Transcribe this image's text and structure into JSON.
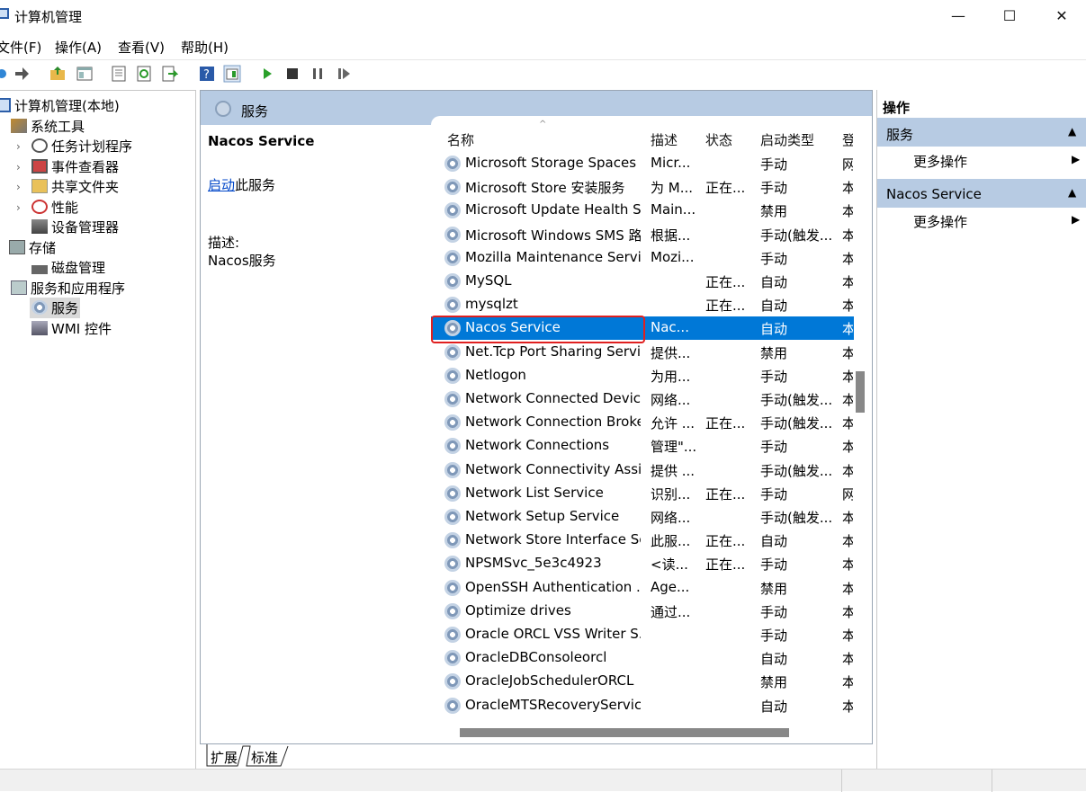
{
  "window": {
    "title": "计算机管理",
    "minimize": "—",
    "maximize": "☐",
    "close": "✕"
  },
  "menu": [
    "文件(F)",
    "操作(A)",
    "查看(V)",
    "帮助(H)"
  ],
  "tree": {
    "root": "计算机管理(本地)",
    "system_tools": "系统工具",
    "task_scheduler": "任务计划程序",
    "event_viewer": "事件查看器",
    "shared_folders": "共享文件夹",
    "performance": "性能",
    "device_manager": "设备管理器",
    "storage": "存储",
    "disk_management": "磁盘管理",
    "services_apps": "服务和应用程序",
    "services": "服务",
    "wmi": "WMI 控件"
  },
  "center": {
    "header": "服务",
    "detail_title": "Nacos Service",
    "start_link": "启动",
    "start_suffix": "此服务",
    "desc_label": "描述:",
    "desc_value": "Nacos服务"
  },
  "columns": [
    "名称",
    "描述",
    "状态",
    "启动类型",
    "登"
  ],
  "rows": [
    {
      "name": "Microsoft Storage Spaces S...",
      "desc": "Micr...",
      "status": "",
      "startup": "手动",
      "logon": "网"
    },
    {
      "name": "Microsoft Store 安装服务",
      "desc": "为 M...",
      "status": "正在...",
      "startup": "手动",
      "logon": "本"
    },
    {
      "name": "Microsoft Update Health S...",
      "desc": "Main...",
      "status": "",
      "startup": "禁用",
      "logon": "本"
    },
    {
      "name": "Microsoft Windows SMS 路...",
      "desc": "根据...",
      "status": "",
      "startup": "手动(触发...",
      "logon": "本"
    },
    {
      "name": "Mozilla Maintenance Service",
      "desc": "Mozi...",
      "status": "",
      "startup": "手动",
      "logon": "本"
    },
    {
      "name": "MySQL",
      "desc": "",
      "status": "正在...",
      "startup": "自动",
      "logon": "本"
    },
    {
      "name": "mysqlzt",
      "desc": "",
      "status": "正在...",
      "startup": "自动",
      "logon": "本"
    },
    {
      "name": "Nacos Service",
      "desc": "Nac...",
      "status": "",
      "startup": "自动",
      "logon": "本"
    },
    {
      "name": "Net.Tcp Port Sharing Service",
      "desc": "提供...",
      "status": "",
      "startup": "禁用",
      "logon": "本"
    },
    {
      "name": "Netlogon",
      "desc": "为用...",
      "status": "",
      "startup": "手动",
      "logon": "本"
    },
    {
      "name": "Network Connected Devic...",
      "desc": "网络...",
      "status": "",
      "startup": "手动(触发...",
      "logon": "本"
    },
    {
      "name": "Network Connection Broker",
      "desc": "允许 ...",
      "status": "正在...",
      "startup": "手动(触发...",
      "logon": "本"
    },
    {
      "name": "Network Connections",
      "desc": "管理\"...",
      "status": "",
      "startup": "手动",
      "logon": "本"
    },
    {
      "name": "Network Connectivity Assis...",
      "desc": "提供 ...",
      "status": "",
      "startup": "手动(触发...",
      "logon": "本"
    },
    {
      "name": "Network List Service",
      "desc": "识别...",
      "status": "正在...",
      "startup": "手动",
      "logon": "网"
    },
    {
      "name": "Network Setup Service",
      "desc": "网络...",
      "status": "",
      "startup": "手动(触发...",
      "logon": "本"
    },
    {
      "name": "Network Store Interface Se...",
      "desc": "此服...",
      "status": "正在...",
      "startup": "自动",
      "logon": "本"
    },
    {
      "name": "NPSMSvc_5e3c4923",
      "desc": "<读...",
      "status": "正在...",
      "startup": "手动",
      "logon": "本"
    },
    {
      "name": "OpenSSH Authentication ...",
      "desc": "Age...",
      "status": "",
      "startup": "禁用",
      "logon": "本"
    },
    {
      "name": "Optimize drives",
      "desc": "通过...",
      "status": "",
      "startup": "手动",
      "logon": "本"
    },
    {
      "name": "Oracle ORCL VSS Writer S...",
      "desc": "",
      "status": "",
      "startup": "手动",
      "logon": "本"
    },
    {
      "name": "OracleDBConsoleorcl",
      "desc": "",
      "status": "",
      "startup": "自动",
      "logon": "本"
    },
    {
      "name": "OracleJobSchedulerORCL",
      "desc": "",
      "status": "",
      "startup": "禁用",
      "logon": "本"
    },
    {
      "name": "OracleMTSRecoveryService",
      "desc": "",
      "status": "",
      "startup": "自动",
      "logon": "本"
    }
  ],
  "tabs": [
    "扩展",
    "标准"
  ],
  "actions": {
    "header": "操作",
    "section1": "服务",
    "more1": "更多操作",
    "section2": "Nacos Service",
    "more2": "更多操作"
  },
  "colors": {
    "selection": "#0078d7",
    "highlight_box": "#e02020",
    "section_bg": "#b7cbe3"
  }
}
